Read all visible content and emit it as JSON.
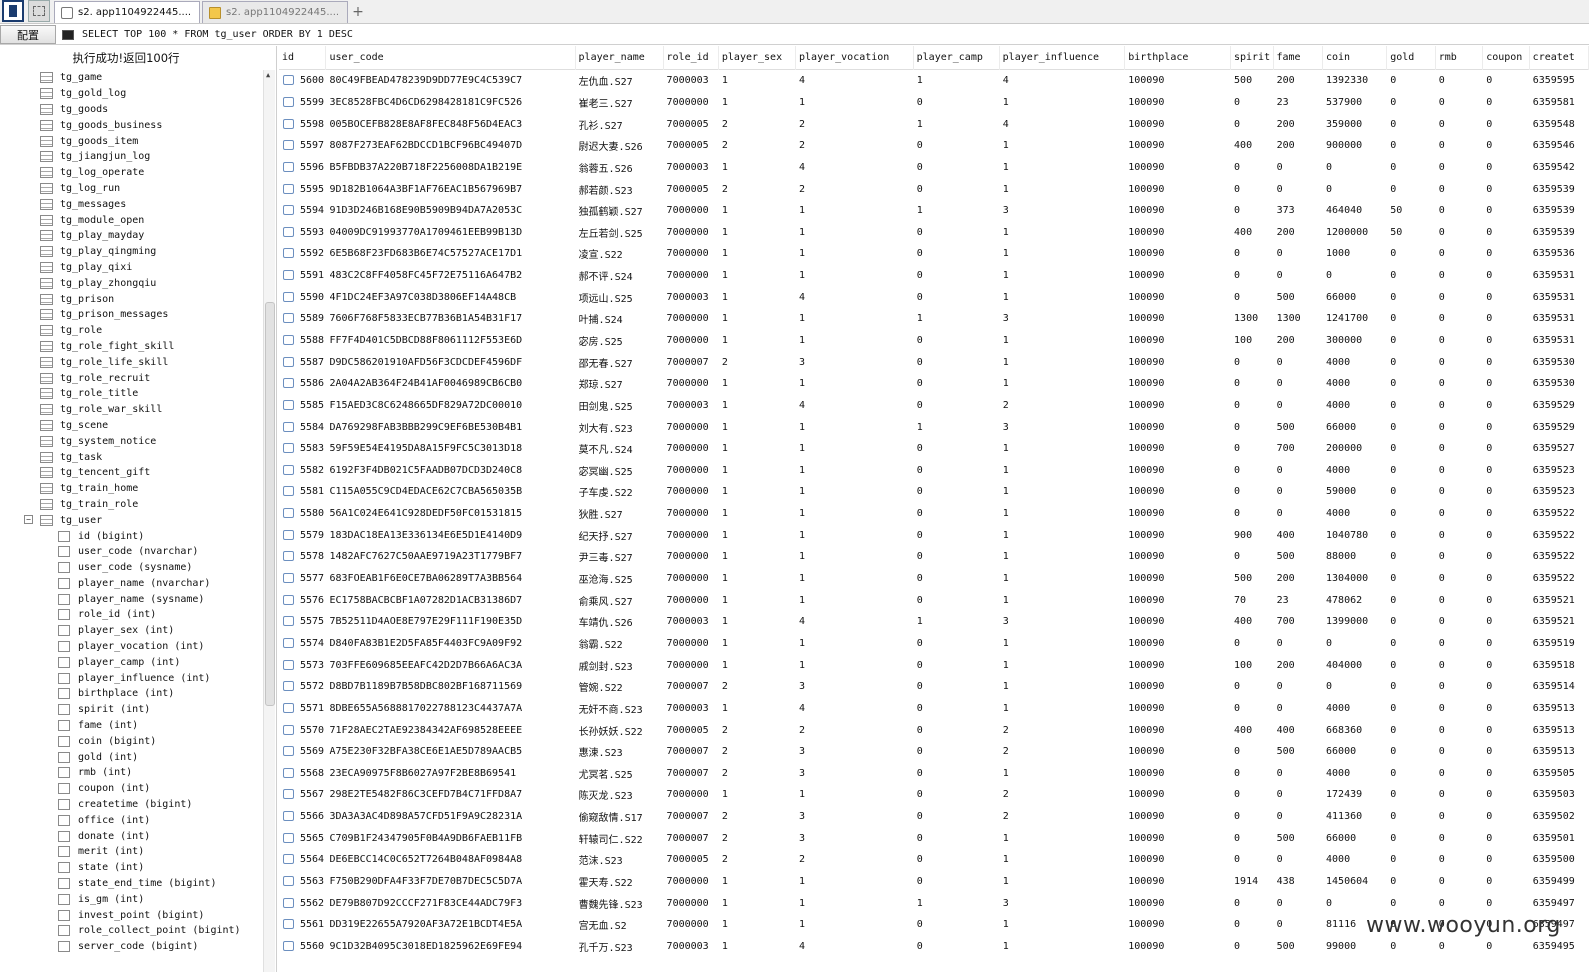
{
  "tabs": [
    {
      "label": "s2. app1104922445....",
      "active": true
    },
    {
      "label": "s2. app1104922445....",
      "active": false
    }
  ],
  "toolbar": {
    "config_label": "配置",
    "query": "SELECT TOP 100 * FROM tg_user ORDER BY 1 DESC"
  },
  "status_text": "执行成功!返回100行",
  "tree": {
    "tables": [
      "tg_game",
      "tg_gold_log",
      "tg_goods",
      "tg_goods_business",
      "tg_goods_item",
      "tg_jiangjun_log",
      "tg_log_operate",
      "tg_log_run",
      "tg_messages",
      "tg_module_open",
      "tg_play_mayday",
      "tg_play_qingming",
      "tg_play_qixi",
      "tg_play_zhongqiu",
      "tg_prison",
      "tg_prison_messages",
      "tg_role",
      "tg_role_fight_skill",
      "tg_role_life_skill",
      "tg_role_recruit",
      "tg_role_title",
      "tg_role_war_skill",
      "tg_scene",
      "tg_system_notice",
      "tg_task",
      "tg_tencent_gift",
      "tg_train_home",
      "tg_train_role"
    ],
    "expanded_table": "tg_user",
    "columns": [
      "id (bigint)",
      "user_code (nvarchar)",
      "user_code (sysname)",
      "player_name (nvarchar)",
      "player_name (sysname)",
      "role_id (int)",
      "player_sex (int)",
      "player_vocation (int)",
      "player_camp (int)",
      "player_influence (int)",
      "birthplace (int)",
      "spirit (int)",
      "fame (int)",
      "coin (bigint)",
      "gold (int)",
      "rmb (int)",
      "coupon (int)",
      "createtime (bigint)",
      "office (int)",
      "donate (int)",
      "merit (int)",
      "state (int)",
      "state_end_time (bigint)",
      "is_gm (int)",
      "invest_point (bigint)",
      "role_collect_point (bigint)",
      "server_code (bigint)"
    ]
  },
  "grid": {
    "headers": [
      "id",
      "user_code",
      "player_name",
      "role_id",
      "player_sex",
      "player_vocation",
      "player_camp",
      "player_influence",
      "birthplace",
      "spirit",
      "fame",
      "coin",
      "gold",
      "rmb",
      "coupon",
      "createt"
    ],
    "rows": [
      [
        "5600",
        "80C49FBEAD478239D9DD77E9C4C539C7",
        "左仇血.S27",
        "7000003",
        "1",
        "4",
        "1",
        "4",
        "100090",
        "500",
        "200",
        "1392330",
        "0",
        "0",
        "0",
        "6359595"
      ],
      [
        "5599",
        "3EC8528FBC4D6CD6298428181C9FC526",
        "崔老三.S27",
        "7000000",
        "1",
        "1",
        "0",
        "1",
        "100090",
        "0",
        "23",
        "537900",
        "0",
        "0",
        "0",
        "6359581"
      ],
      [
        "5598",
        "005BOCEFB828E8AF8FEC848F56D4EAC3",
        "孔衫.S27",
        "7000005",
        "2",
        "2",
        "1",
        "4",
        "100090",
        "0",
        "200",
        "359000",
        "0",
        "0",
        "0",
        "6359548"
      ],
      [
        "5597",
        "8087F273EAF62BDCCD1BCF96BC49407D",
        "尉迟大妻.S26",
        "7000005",
        "2",
        "2",
        "0",
        "1",
        "100090",
        "400",
        "200",
        "900000",
        "0",
        "0",
        "0",
        "6359546"
      ],
      [
        "5596",
        "B5FBDB37A220B718F2256008DA1B219E",
        "翁蓉五.S26",
        "7000003",
        "1",
        "4",
        "0",
        "1",
        "100090",
        "0",
        "0",
        "0",
        "0",
        "0",
        "0",
        "6359542"
      ],
      [
        "5595",
        "9D182B1064A3BF1AF76EAC1B567969B7",
        "郝若颜.S23",
        "7000005",
        "2",
        "2",
        "0",
        "1",
        "100090",
        "0",
        "0",
        "0",
        "0",
        "0",
        "0",
        "6359539"
      ],
      [
        "5594",
        "91D3D246B168E90B5909B94DA7A2053C",
        "独孤鹤颖.S27",
        "7000000",
        "1",
        "1",
        "1",
        "3",
        "100090",
        "0",
        "373",
        "464040",
        "50",
        "0",
        "0",
        "6359539"
      ],
      [
        "5593",
        "04009DC91993770A1709461EEB99B13D",
        "左丘若剑.S25",
        "7000000",
        "1",
        "1",
        "0",
        "1",
        "100090",
        "400",
        "200",
        "1200000",
        "50",
        "0",
        "0",
        "6359539"
      ],
      [
        "5592",
        "6E5B68F23FD683B6E74C57527ACE17D1",
        "凌宣.S22",
        "7000000",
        "1",
        "1",
        "0",
        "1",
        "100090",
        "0",
        "0",
        "1000",
        "0",
        "0",
        "0",
        "6359536"
      ],
      [
        "5591",
        "483C2C8FF4058FC45F72E75116A647B2",
        "郝不评.S24",
        "7000000",
        "1",
        "1",
        "0",
        "1",
        "100090",
        "0",
        "0",
        "0",
        "0",
        "0",
        "0",
        "6359531"
      ],
      [
        "5590",
        "4F1DC24EF3A97C038D3806EF14A48CB",
        "项远山.S25",
        "7000003",
        "1",
        "4",
        "0",
        "1",
        "100090",
        "0",
        "500",
        "66000",
        "0",
        "0",
        "0",
        "6359531"
      ],
      [
        "5589",
        "7606F768F5833ECB77B36B1A54B31F17",
        "叶捕.S24",
        "7000000",
        "1",
        "1",
        "1",
        "3",
        "100090",
        "1300",
        "1300",
        "1241700",
        "0",
        "0",
        "0",
        "6359531"
      ],
      [
        "5588",
        "FF7F4D401C5DBCD88F8061112F553E6D",
        "宓房.S25",
        "7000000",
        "1",
        "1",
        "0",
        "1",
        "100090",
        "100",
        "200",
        "300000",
        "0",
        "0",
        "0",
        "6359531"
      ],
      [
        "5587",
        "D9DC586201910AFD56F3CDCDEF4596DF",
        "邵无春.S27",
        "7000007",
        "2",
        "3",
        "0",
        "1",
        "100090",
        "0",
        "0",
        "4000",
        "0",
        "0",
        "0",
        "6359530"
      ],
      [
        "5586",
        "2A04A2AB364F24B41AF0046989CB6CB0",
        "郑琼.S27",
        "7000000",
        "1",
        "1",
        "0",
        "1",
        "100090",
        "0",
        "0",
        "4000",
        "0",
        "0",
        "0",
        "6359530"
      ],
      [
        "5585",
        "F15AED3C8C6248665DF829A72DC00010",
        "田剑鬼.S25",
        "7000003",
        "1",
        "4",
        "0",
        "2",
        "100090",
        "0",
        "0",
        "4000",
        "0",
        "0",
        "0",
        "6359529"
      ],
      [
        "5584",
        "DA769298FAB3BBB299C9EF6BE530B4B1",
        "刘大有.S23",
        "7000000",
        "1",
        "1",
        "1",
        "3",
        "100090",
        "0",
        "500",
        "66000",
        "0",
        "0",
        "0",
        "6359529"
      ],
      [
        "5583",
        "59F59E54E4195DA8A15F9FC5C3013D18",
        "莫不凡.S24",
        "7000000",
        "1",
        "1",
        "0",
        "1",
        "100090",
        "0",
        "700",
        "200000",
        "0",
        "0",
        "0",
        "6359527"
      ],
      [
        "5582",
        "6192F3F4DB021C5FAADB07DCD3D240C8",
        "宓冥幽.S25",
        "7000000",
        "1",
        "1",
        "0",
        "1",
        "100090",
        "0",
        "0",
        "4000",
        "0",
        "0",
        "0",
        "6359523"
      ],
      [
        "5581",
        "C115A055C9CD4EDACE62C7CBA565035B",
        "子车虔.S22",
        "7000000",
        "1",
        "1",
        "0",
        "1",
        "100090",
        "0",
        "0",
        "59000",
        "0",
        "0",
        "0",
        "6359523"
      ],
      [
        "5580",
        "56A1C024E641C928DEDF50FC01531815",
        "狄胜.S27",
        "7000000",
        "1",
        "1",
        "0",
        "1",
        "100090",
        "0",
        "0",
        "4000",
        "0",
        "0",
        "0",
        "6359522"
      ],
      [
        "5579",
        "183DAC18EA13E336134E6E5D1E4140D9",
        "纪天抒.S27",
        "7000000",
        "1",
        "1",
        "0",
        "1",
        "100090",
        "900",
        "400",
        "1040780",
        "0",
        "0",
        "0",
        "6359522"
      ],
      [
        "5578",
        "1482AFC7627C50AAE9719A23T1779BF7",
        "尹三毒.S27",
        "7000000",
        "1",
        "1",
        "0",
        "1",
        "100090",
        "0",
        "500",
        "88000",
        "0",
        "0",
        "0",
        "6359522"
      ],
      [
        "5577",
        "683FOEAB1F6E0CE7BA06289T7A3BB564",
        "巫沧海.S25",
        "7000000",
        "1",
        "1",
        "0",
        "1",
        "100090",
        "500",
        "200",
        "1304000",
        "0",
        "0",
        "0",
        "6359522"
      ],
      [
        "5576",
        "EC1758BACBCBF1A07282D1ACB31386D7",
        "俞乘风.S27",
        "7000000",
        "1",
        "1",
        "0",
        "1",
        "100090",
        "70",
        "23",
        "478062",
        "0",
        "0",
        "0",
        "6359521"
      ],
      [
        "5575",
        "7B52511D4AOE8E797E29F111F190E35D",
        "车靖仇.S26",
        "7000003",
        "1",
        "4",
        "1",
        "3",
        "100090",
        "400",
        "700",
        "1399000",
        "0",
        "0",
        "0",
        "6359521"
      ],
      [
        "5574",
        "D840FA83B1E2D5FA85F4403FC9A09F92",
        "翁霸.S22",
        "7000000",
        "1",
        "1",
        "0",
        "1",
        "100090",
        "0",
        "0",
        "0",
        "0",
        "0",
        "0",
        "6359519"
      ],
      [
        "5573",
        "703FFE609685EEAFC42D2D7B66A6AC3A",
        "戚剑封.S23",
        "7000000",
        "1",
        "1",
        "0",
        "1",
        "100090",
        "100",
        "200",
        "404000",
        "0",
        "0",
        "0",
        "6359518"
      ],
      [
        "5572",
        "D8BD7B1189B7B58DBC802BF168711569",
        "管婉.S22",
        "7000007",
        "2",
        "3",
        "0",
        "1",
        "100090",
        "0",
        "0",
        "0",
        "0",
        "0",
        "0",
        "6359514"
      ],
      [
        "5571",
        "8DBE655A5688817022788123C4437A7A",
        "无奸不商.S23",
        "7000003",
        "1",
        "4",
        "0",
        "1",
        "100090",
        "0",
        "0",
        "4000",
        "0",
        "0",
        "0",
        "6359513"
      ],
      [
        "5570",
        "71F28AEC2TAE92384342AF698528EEEE",
        "长孙妖妖.S22",
        "7000005",
        "2",
        "2",
        "0",
        "2",
        "100090",
        "400",
        "400",
        "668360",
        "0",
        "0",
        "0",
        "6359513"
      ],
      [
        "5569",
        "A75E230F32BFA38CE6E1AE5D789AACB5",
        "惠涑.S23",
        "7000007",
        "2",
        "3",
        "0",
        "2",
        "100090",
        "0",
        "500",
        "66000",
        "0",
        "0",
        "0",
        "6359513"
      ],
      [
        "5568",
        "23ECA90975F8B6027A97F2BE8B69541",
        "尤冥茗.S25",
        "7000007",
        "2",
        "3",
        "0",
        "1",
        "100090",
        "0",
        "0",
        "4000",
        "0",
        "0",
        "0",
        "6359505"
      ],
      [
        "5567",
        "298E2TE5482F86C3CEFD7B4C71FFD8A7",
        "陈灭龙.S23",
        "7000000",
        "1",
        "1",
        "0",
        "2",
        "100090",
        "0",
        "0",
        "172439",
        "0",
        "0",
        "0",
        "6359503"
      ],
      [
        "5566",
        "3DA3A3AC4D898A57CFD51F9A9C28231A",
        "偷窥敌情.S17",
        "7000007",
        "2",
        "3",
        "0",
        "2",
        "100090",
        "0",
        "0",
        "411360",
        "0",
        "0",
        "0",
        "6359502"
      ],
      [
        "5565",
        "C709B1F24347905F0B4A9DB6FAEB11FB",
        "轩辕司仁.S22",
        "7000007",
        "2",
        "3",
        "0",
        "1",
        "100090",
        "0",
        "500",
        "66000",
        "0",
        "0",
        "0",
        "6359501"
      ],
      [
        "5564",
        "DE6EBCC14C0C652T7264B048AF0984A8",
        "范沫.S23",
        "7000005",
        "2",
        "2",
        "0",
        "1",
        "100090",
        "0",
        "0",
        "4000",
        "0",
        "0",
        "0",
        "6359500"
      ],
      [
        "5563",
        "F750B290DFA4F33F7DE70B7DEC5C5D7A",
        "霍天寿.S22",
        "7000000",
        "1",
        "1",
        "0",
        "1",
        "100090",
        "1914",
        "438",
        "1450604",
        "0",
        "0",
        "0",
        "6359499"
      ],
      [
        "5562",
        "DE79B807D92CCCF271F83CE44ADC79F3",
        "曹魏先锋.S23",
        "7000000",
        "1",
        "1",
        "1",
        "3",
        "100090",
        "0",
        "0",
        "0",
        "0",
        "0",
        "0",
        "6359497"
      ],
      [
        "5561",
        "DD319E22655A7920AF3A72E1BCDT4E5A",
        "宫无血.S2",
        "7000000",
        "1",
        "1",
        "0",
        "1",
        "100090",
        "0",
        "0",
        "81116",
        "0",
        "0",
        "0",
        "6359497"
      ],
      [
        "5560",
        "9C1D32B4095C3018ED1825962E69FE94",
        "孔千万.S23",
        "7000003",
        "1",
        "4",
        "0",
        "1",
        "100090",
        "0",
        "500",
        "99000",
        "0",
        "0",
        "0",
        "6359495"
      ]
    ]
  },
  "watermark": "www.wooyun.org"
}
